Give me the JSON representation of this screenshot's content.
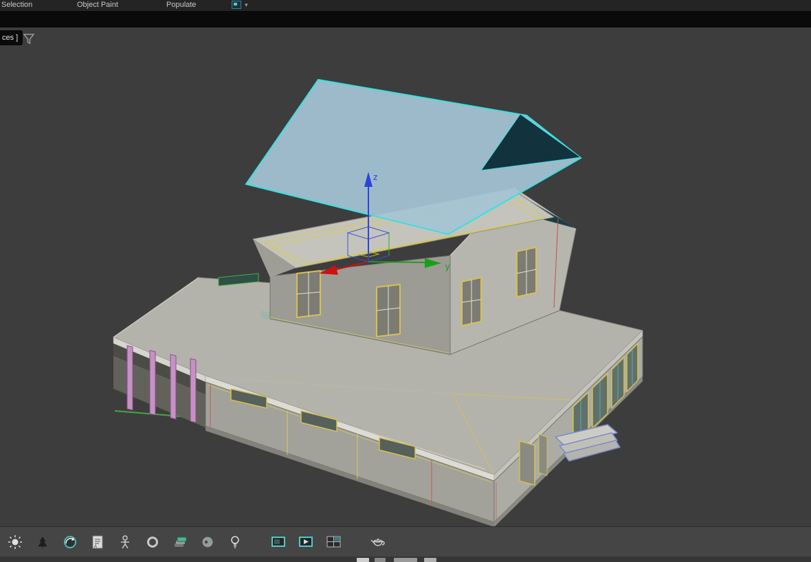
{
  "ribbon": {
    "tabs": [
      {
        "label": "Selection"
      },
      {
        "label": "Object Paint"
      },
      {
        "label": "Populate"
      }
    ],
    "dropdown_caret": "▾"
  },
  "viewport": {
    "label_fragment": "ces ]",
    "background_color": "#3d3d3d",
    "selection_color": "#3ae0e0",
    "roof_fill_color": "#a4c4d4",
    "gizmo": {
      "z_label": "z",
      "y_label": "y",
      "x_color": "#cc1111",
      "y_color": "#18a018",
      "z_color": "#2a44e0"
    }
  },
  "toolbar": {
    "icons": [
      {
        "name": "sun"
      },
      {
        "name": "tree"
      },
      {
        "name": "orbit"
      },
      {
        "name": "annotation"
      },
      {
        "name": "character"
      },
      {
        "name": "ring"
      },
      {
        "name": "layers"
      },
      {
        "name": "palette"
      },
      {
        "name": "light-bulb"
      },
      {
        "name": "viewport-monitor"
      },
      {
        "name": "viewport-play"
      },
      {
        "name": "viewport-split"
      },
      {
        "name": "teapot"
      }
    ]
  }
}
